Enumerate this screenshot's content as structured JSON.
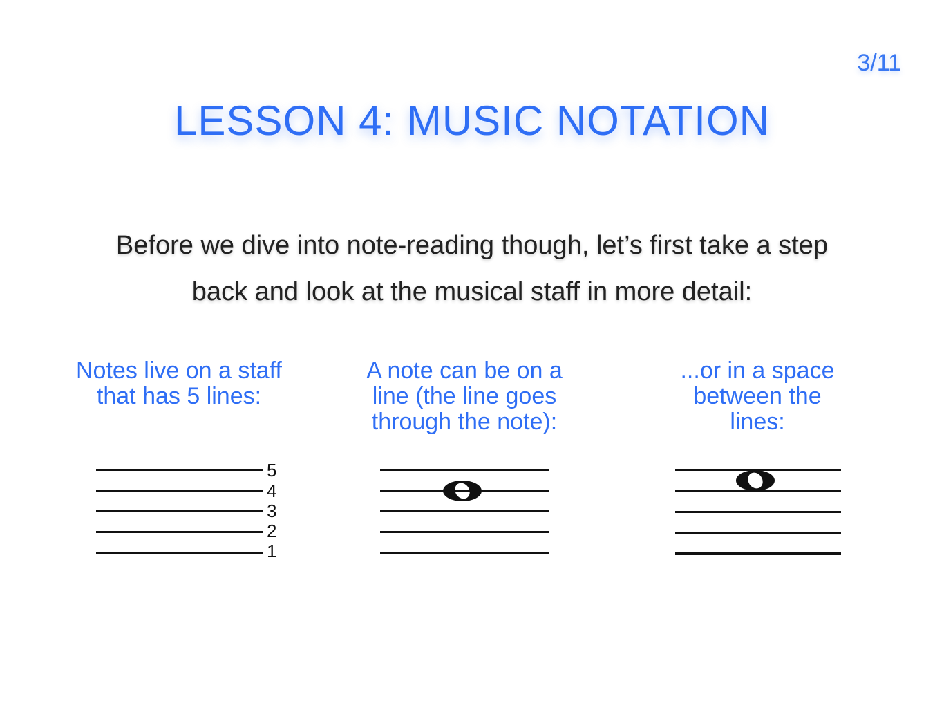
{
  "slide": {
    "page_number": "3/11",
    "title": "LESSON 4: MUSIC NOTATION",
    "intro": "Before we dive into note-reading though, let’s first take a step back and look at the musical staff in more detail:",
    "accent_color": "#2f6ef5"
  },
  "columns": [
    {
      "caption": "Notes live on a staff that has 5 lines:",
      "line_numbers": [
        "5",
        "4",
        "3",
        "2",
        "1"
      ]
    },
    {
      "caption": "A note can be on a line (the line goes through the note):",
      "note_position": "line 4"
    },
    {
      "caption": "...or in a space between the lines:",
      "note_position": "space between lines 4 and 5"
    }
  ]
}
